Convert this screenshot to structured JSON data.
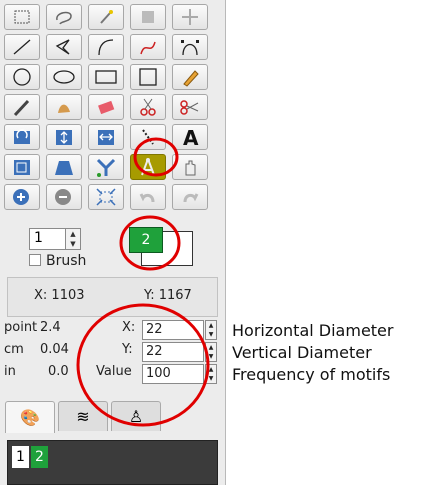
{
  "tools": [
    [
      "rectangle-select-icon",
      "lasso-icon",
      "magic-wand-icon",
      "crop-icon",
      "move-icon"
    ],
    [
      "line-icon",
      "polyline-icon",
      "arc-icon",
      "curve-icon",
      "bezier-icon"
    ],
    [
      "circle-icon",
      "ellipse-icon",
      "rectangle-icon",
      "square-icon",
      "pencil-icon"
    ],
    [
      "knife-icon",
      "smudge-icon",
      "eraser-icon",
      "scissors-icon",
      "cutter-icon"
    ],
    [
      "rotate-icon",
      "flip-vertical-icon",
      "flip-horizontal-icon",
      "dotted-line-icon",
      "text-icon"
    ],
    [
      "resize-icon",
      "perspective-icon",
      "symmetry-icon",
      "compass-icon",
      "hand-icon"
    ],
    [
      "zoom-in-icon",
      "zoom-out-icon",
      "zoom-fit-icon",
      "undo-icon",
      "redo-icon"
    ]
  ],
  "brush": {
    "size": "1",
    "label": "Brush",
    "color_number": "2"
  },
  "coords": {
    "x": "X: 1103",
    "y": "Y: 1167"
  },
  "units": [
    {
      "unit": "point",
      "value": "2.4"
    },
    {
      "unit": "cm",
      "value": "0.04"
    },
    {
      "unit": "in",
      "value": "0.0"
    }
  ],
  "fields": [
    {
      "label": "X:",
      "value": "22",
      "annotation": "Horizontal Diameter"
    },
    {
      "label": "Y:",
      "value": "22",
      "annotation": "Vertical Diameter"
    },
    {
      "label": "Value",
      "value": "100",
      "annotation": "Frequency of motifs"
    }
  ],
  "layers": [
    {
      "label": "1"
    },
    {
      "label": "2"
    }
  ],
  "colors": {
    "accent_green": "#1fa13b",
    "active_tool": "#a79b00",
    "highlight_circle": "#e00000"
  }
}
